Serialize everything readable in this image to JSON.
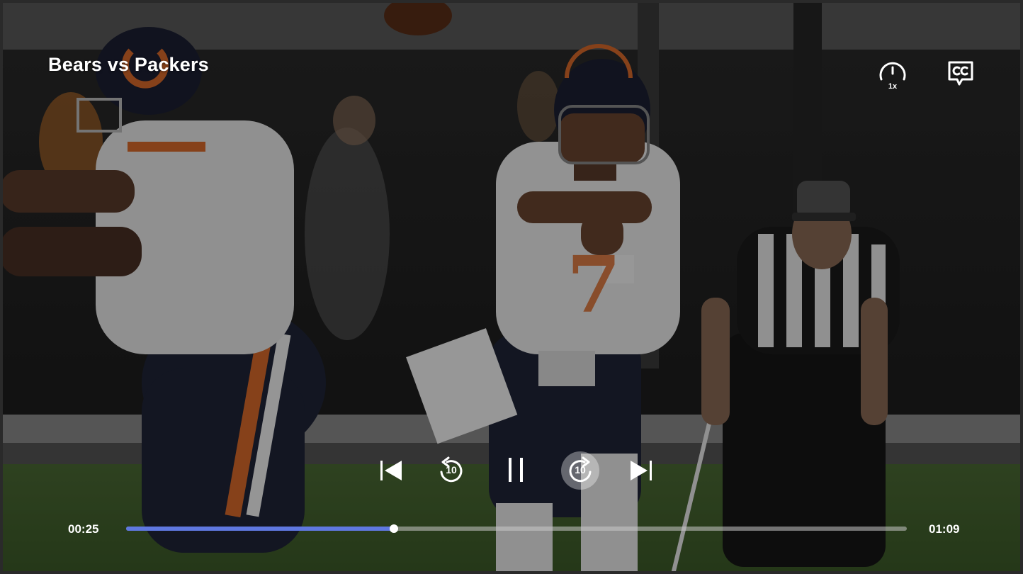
{
  "video": {
    "title": "Bears vs Packers",
    "scene": "football-game-frame"
  },
  "controls": {
    "speed": {
      "label": "1x",
      "icon": "playback-speed-icon"
    },
    "captions": {
      "icon": "closed-captions-icon"
    },
    "previous": {
      "icon": "skip-previous-icon"
    },
    "rewind": {
      "icon": "rewind-10-icon",
      "seconds": "10"
    },
    "play_pause": {
      "icon": "pause-icon",
      "state": "playing"
    },
    "forward": {
      "icon": "forward-10-icon",
      "seconds": "10"
    },
    "next": {
      "icon": "skip-next-icon"
    }
  },
  "progress": {
    "current_time": "00:25",
    "total_time": "01:09",
    "fraction": 0.343
  },
  "colors": {
    "progress_fill": "#5f78e0",
    "progress_track": "#c8c8c8",
    "text": "#ffffff"
  }
}
